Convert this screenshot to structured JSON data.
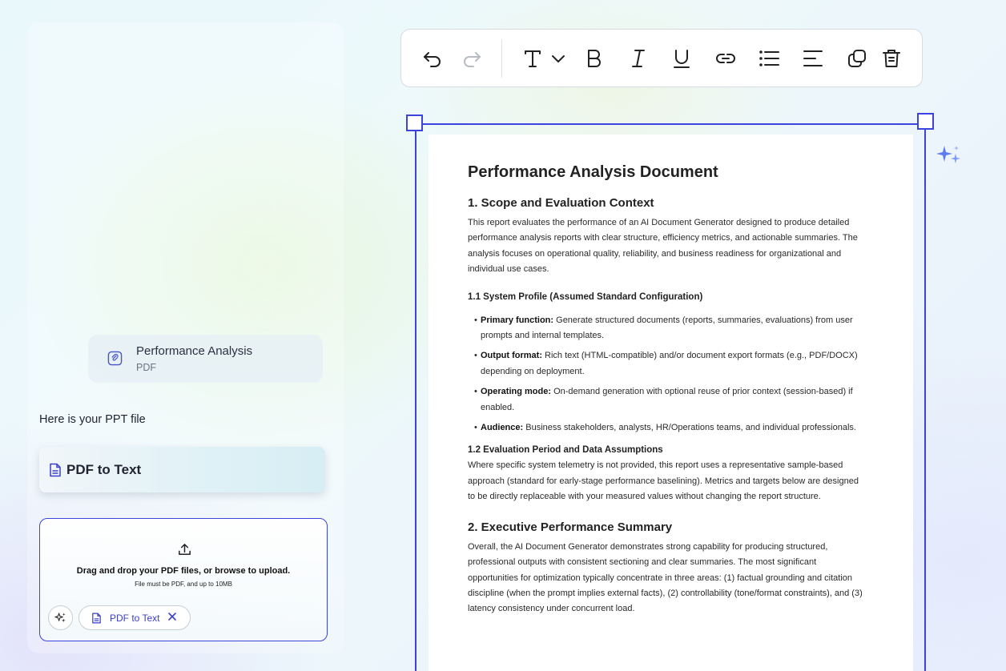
{
  "chat": {
    "attachment": {
      "name": "Performance Analysis",
      "type": "PDF"
    },
    "reply": "Here is your PPT file",
    "result_card": {
      "label": "PDF to Text"
    }
  },
  "upload": {
    "title": "Drag and drop your PDF files, or browse to upload.",
    "subtitle": "File must be PDF, and up to 10MB",
    "tool_chip": {
      "label": "PDF to Text"
    }
  },
  "toolbar": {
    "buttons": [
      "undo-icon",
      "redo-icon",
      "text-style-icon",
      "chevron-down-icon",
      "bold-icon",
      "italic-icon",
      "underline-icon",
      "link-icon",
      "bullet-list-icon",
      "align-left-icon",
      "copy-icon",
      "delete-icon"
    ]
  },
  "document": {
    "title": "Performance Analysis Document",
    "s1": {
      "heading": "1. Scope and Evaluation Context",
      "body": "This report evaluates the performance of an AI Document Generator designed to produce detailed performance analysis reports with clear structure, efficiency metrics, and actionable summaries. The analysis focuses on operational quality, reliability, and business readiness for organizational and individual use cases."
    },
    "s11": {
      "heading": "1.1 System Profile (Assumed Standard Configuration)",
      "items": [
        {
          "term": "Primary function:",
          "text": " Generate structured documents (reports, summaries, evaluations) from user prompts and internal templates."
        },
        {
          "term": "Output format:",
          "text": " Rich text (HTML-compatible) and/or document export formats (e.g., PDF/DOCX) depending on deployment."
        },
        {
          "term": "Operating mode:",
          "text": " On-demand generation with optional reuse of prior context (session-based) if enabled."
        },
        {
          "term": "Audience:",
          "text": " Business stakeholders, analysts, HR/Operations teams, and individual professionals."
        }
      ]
    },
    "s12": {
      "heading": "1.2 Evaluation Period and Data Assumptions",
      "body": "Where specific system telemetry is not provided, this report uses a representative sample-based approach (standard for early-stage performance baselining). Metrics and targets below are designed to be directly replaceable with your measured values without changing the report structure."
    },
    "s2": {
      "heading": "2. Executive Performance Summary",
      "body": "Overall, the AI Document Generator demonstrates strong capability for producing structured, professional outputs with consistent sectioning and clear summaries. The most significant opportunities for optimization typically concentrate in three areas: (1) factual grounding and citation discipline (when the prompt implies external facts), (2) controllability (tone/format constraints), and (3) latency consistency under concurrent load."
    }
  },
  "colors": {
    "accent": "#3c44e0",
    "link": "#3b3fc9"
  }
}
